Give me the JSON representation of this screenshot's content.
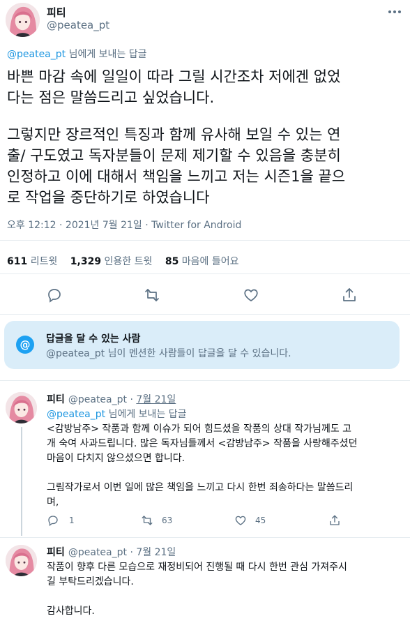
{
  "main_tweet": {
    "author_name": "피티",
    "author_handle": "@peatea_pt",
    "more_icon": "more-icon",
    "replying_to_handle": "@peatea_pt",
    "replying_to_suffix": " 님에게 보내는 답글",
    "paragraph_1": "바쁜 마감 속에 일일이 따라 그릴 시간조차 저에겐 없었\n다는 점은 말씀드리고 싶었습니다.",
    "paragraph_2": "그렇지만 장르적인 특징과 함께 유사해 보일 수 있는 연\n출/ 구도였고 독자분들이 문제 제기할 수 있음을 충분히\n인정하고 이에 대해서 책임을 느끼고 저는 시즌1을 끝으\n로 작업을 중단하기로 하였습니다",
    "meta": "오후 12:12 · 2021년 7월 21일 · Twitter for Android",
    "stats": {
      "retweets_count": "611",
      "retweets_label": "리트윗",
      "quotes_count": "1,329",
      "quotes_label": "인용한 트윗",
      "likes_count": "85",
      "likes_label": "마음에 들어요"
    },
    "actions": [
      "reply-icon",
      "retweet-icon",
      "like-icon",
      "share-icon"
    ]
  },
  "who_can_reply": {
    "icon_glyph": "@",
    "title": "답글을 달 수 있는 사람",
    "subtitle": "@peatea_pt 님이 멘션한 사람들이 답글을 달 수 있습니다."
  },
  "replies": [
    {
      "author_name": "피티",
      "author_handle": "@peatea_pt",
      "separator": " · ",
      "date": "7월 21일",
      "replying_to_handle": "@peatea_pt",
      "replying_to_suffix": " 님에게 보내는 답글",
      "text": "<감방남주> 작품과 함께 이슈가 되어 힘드셨을 작품의 상대 작가님께도 고\n개 숙여 사과드립니다. 많은 독자님들께서 <감방남주> 작품을 사랑해주셨던\n마음이 다치지 않으셨으면 합니다.\n\n그림작가로서 이번 일에 많은 책임을 느끼고 다시 한번 죄송하다는 말씀드리\n며,",
      "reply_count": "1",
      "retweet_count": "63",
      "like_count": "45"
    },
    {
      "author_name": "피티",
      "author_handle": "@peatea_pt",
      "separator": " · ",
      "date": "7월 21일",
      "text": "작품이 향후 다른 모습으로 재정비되어 진행될 때 다시 한번 관심 가져주시\n길 부탁드리겠습니다.\n\n감사합니다."
    }
  ],
  "colors": {
    "link": "#1b95e0",
    "muted": "#5b7083",
    "reply_box_bg": "#daedf9",
    "accent": "#1da1f2"
  }
}
